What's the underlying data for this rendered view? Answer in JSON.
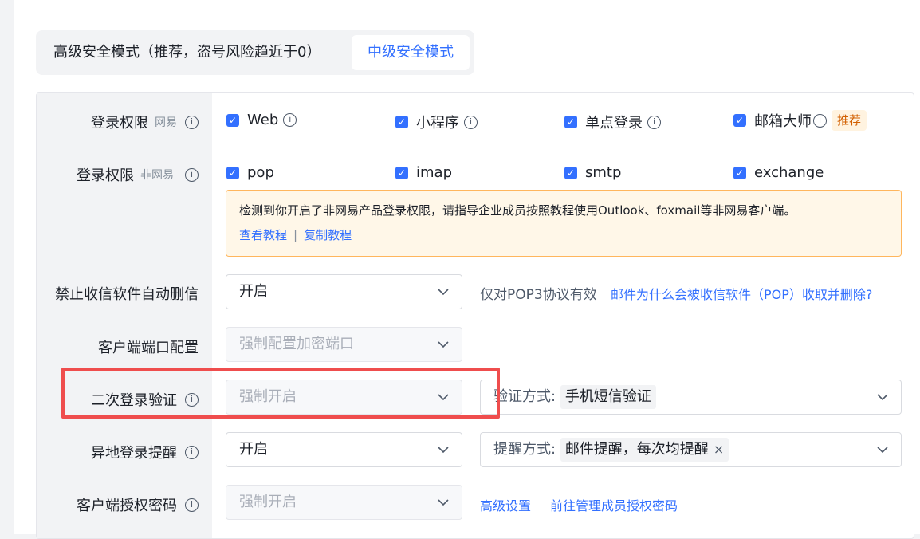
{
  "mode": {
    "high_label": "高级安全模式（推荐，盗号风险趋近于0）",
    "mid_label": "中级安全模式"
  },
  "rows": {
    "login_netease": {
      "label": "登录权限",
      "sub": "网易"
    },
    "login_non_netease": {
      "label": "登录权限",
      "sub": "非网易"
    },
    "auto_delete": {
      "label": "禁止收信软件自动删信"
    },
    "client_port": {
      "label": "客户端端口配置"
    },
    "second_verify": {
      "label": "二次登录验证"
    },
    "remote_login": {
      "label": "异地登录提醒"
    },
    "client_password": {
      "label": "客户端授权密码"
    }
  },
  "netease_options": [
    {
      "label": "Web",
      "checked": true,
      "info": true
    },
    {
      "label": "小程序",
      "checked": true,
      "info": true
    },
    {
      "label": "单点登录",
      "checked": true,
      "info": true
    },
    {
      "label": "邮箱大师",
      "checked": true,
      "info": true,
      "tag": "推荐"
    }
  ],
  "non_netease_options": [
    {
      "label": "pop",
      "checked": true
    },
    {
      "label": "imap",
      "checked": true
    },
    {
      "label": "smtp",
      "checked": true
    },
    {
      "label": "exchange",
      "checked": true
    }
  ],
  "notice": {
    "text": "检测到你开启了非网易产品登录权限，请指导企业成员按照教程使用Outlook、foxmail等非网易客户端。",
    "link_view": "查看教程",
    "separator": "|",
    "link_copy": "复制教程"
  },
  "auto_delete": {
    "value": "开启",
    "hint": "仅对POP3协议有效",
    "link": "邮件为什么会被收信软件（POP）收取并删除?"
  },
  "client_port": {
    "value": "强制配置加密端口"
  },
  "second_verify": {
    "value": "强制开启",
    "method_prefix": "验证方式:",
    "method_value": "手机短信验证"
  },
  "remote_login": {
    "value": "开启",
    "method_prefix": "提醒方式:",
    "method_value": "邮件提醒，每次均提醒",
    "close_glyph": "×"
  },
  "client_password": {
    "value": "强制开启",
    "link_advanced": "高级设置",
    "link_manage": "前往管理成员授权密码"
  },
  "colors": {
    "primary": "#3370ff",
    "highlight": "#ef4d4d",
    "notice_bg": "#fff7e8",
    "notice_border": "#ffb65d"
  }
}
